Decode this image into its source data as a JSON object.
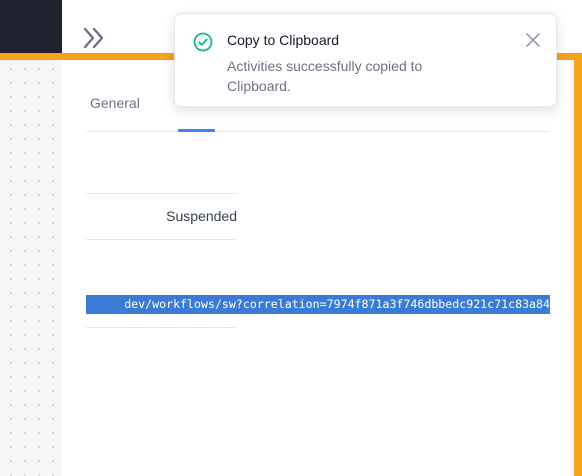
{
  "sidebar": {
    "collapse_icon": "double-chevron-right-icon"
  },
  "tabs": [
    {
      "label": "General",
      "active": false
    }
  ],
  "details": {
    "status_value": "Suspended",
    "correlation_url_visible": "dev/workflows/sw?correlation=7974f871a3f746dbbedc921c71c83a84"
  },
  "toast": {
    "title": "Copy to Clipboard",
    "message": "Activities successfully copied to Clipboard.",
    "icon": "check-circle-icon",
    "close_icon": "close-icon"
  },
  "colors": {
    "topbar": "#1f2430",
    "accent": "#3b82f6",
    "success": "#10b981",
    "highlight_frame": "#f7a21b",
    "selection": "#3a7bd5"
  }
}
